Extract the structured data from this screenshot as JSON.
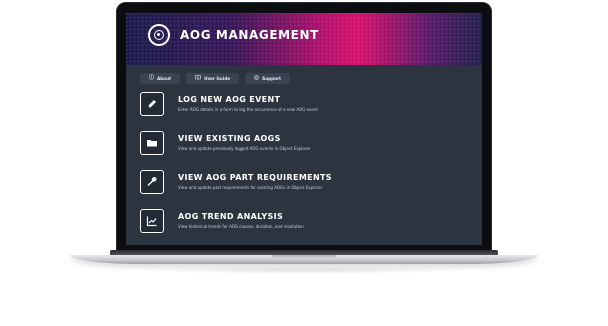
{
  "app": {
    "title": "AOG MANAGEMENT",
    "logo_icon": "target-icon"
  },
  "nav": [
    {
      "label": "About",
      "icon": "info-icon"
    },
    {
      "label": "User Guide",
      "icon": "book-icon"
    },
    {
      "label": "Support",
      "icon": "support-icon"
    }
  ],
  "actions": [
    {
      "title": "LOG NEW AOG EVENT",
      "description": "Enter AOG details in a form to log the occurrence of a new AOG event",
      "icon": "pencil-icon"
    },
    {
      "title": "VIEW EXISTING AOGS",
      "description": "View and update previously logged AOG events in Object Explorer",
      "icon": "folder-icon"
    },
    {
      "title": "VIEW AOG PART REQUIREMENTS",
      "description": "View and update part requirements for existing AOGs in Object Explorer",
      "icon": "wrench-icon"
    },
    {
      "title": "AOG TREND ANALYSIS",
      "description": "View historical trends for AOG causes, duration, and resolution",
      "icon": "chart-icon"
    }
  ],
  "colors": {
    "screen_bg": "#2c3440",
    "accent_magenta": "#d8136b",
    "banner_navy": "#1d1e4e",
    "tile_bg": "#222a35"
  }
}
